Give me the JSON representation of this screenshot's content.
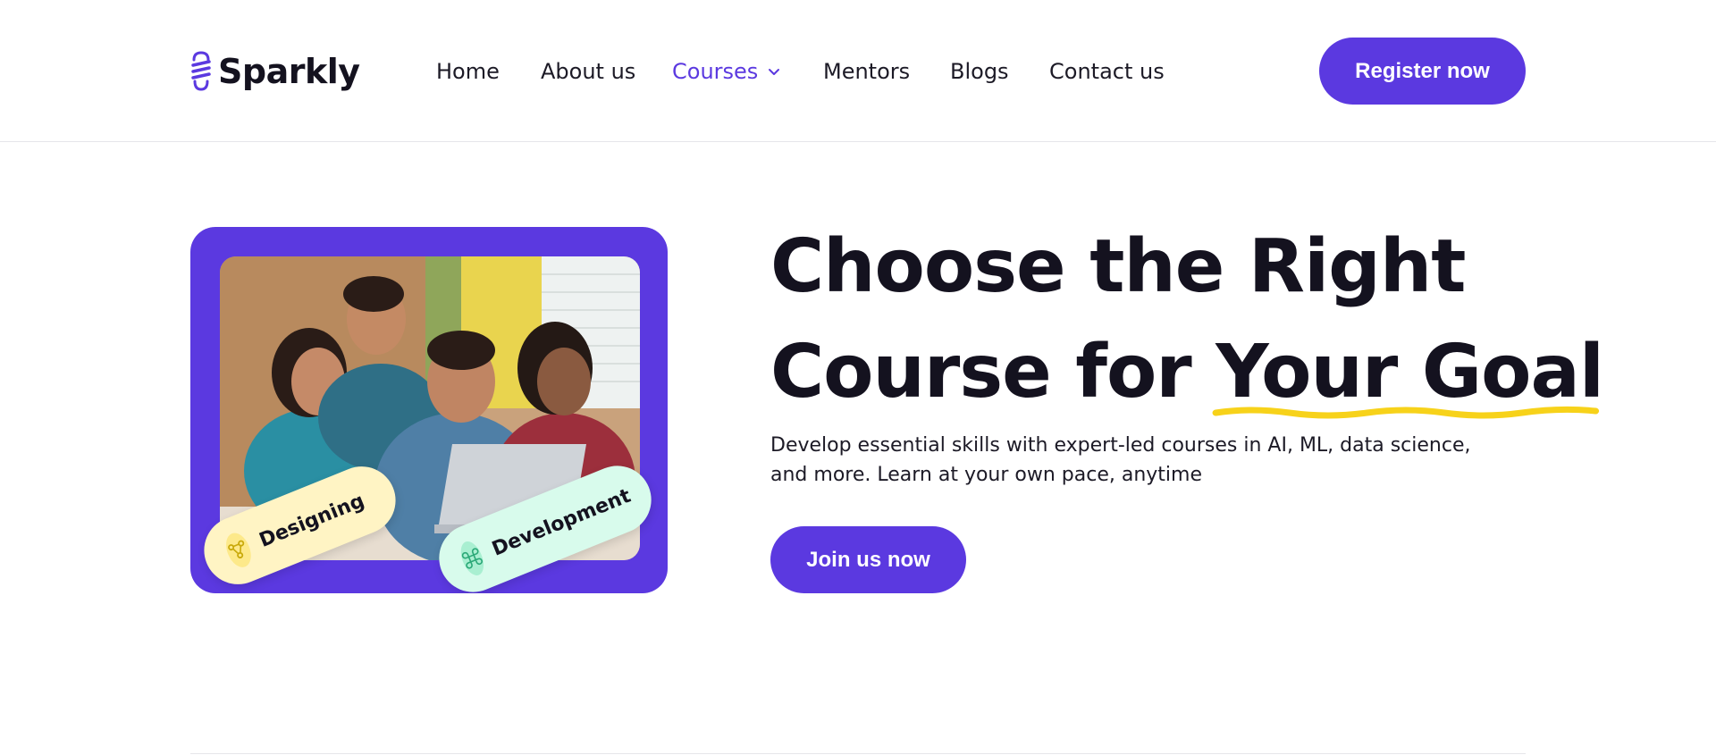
{
  "brand": {
    "name": "Sparkly",
    "logo_icon": "lightbulb-icon",
    "accent_color": "#5b39e0"
  },
  "nav": {
    "items": [
      {
        "label": "Home",
        "active": false
      },
      {
        "label": "About us",
        "active": false
      },
      {
        "label": "Courses",
        "active": true,
        "icon": "chevron-down-icon"
      },
      {
        "label": "Mentors",
        "active": false
      },
      {
        "label": "Blogs",
        "active": false
      },
      {
        "label": "Contact us",
        "active": false
      }
    ]
  },
  "header": {
    "register_label": "Register now"
  },
  "hero": {
    "title_line1": "Choose the Right",
    "title_line2_prefix": "Course for ",
    "title_line2_highlight": "Your Goal",
    "highlight_color": "#f7d21a",
    "subtitle": "Develop essential skills with expert-led courses in AI, ML, data science, and more. Learn at your own pace, anytime",
    "join_label": "Join us now",
    "image_card": {
      "tags": [
        {
          "label": "Designing",
          "icon": "vector-nodes-icon",
          "color": "#fff4c4"
        },
        {
          "label": "Development",
          "icon": "command-icon",
          "color": "#d8fbec"
        }
      ]
    }
  }
}
